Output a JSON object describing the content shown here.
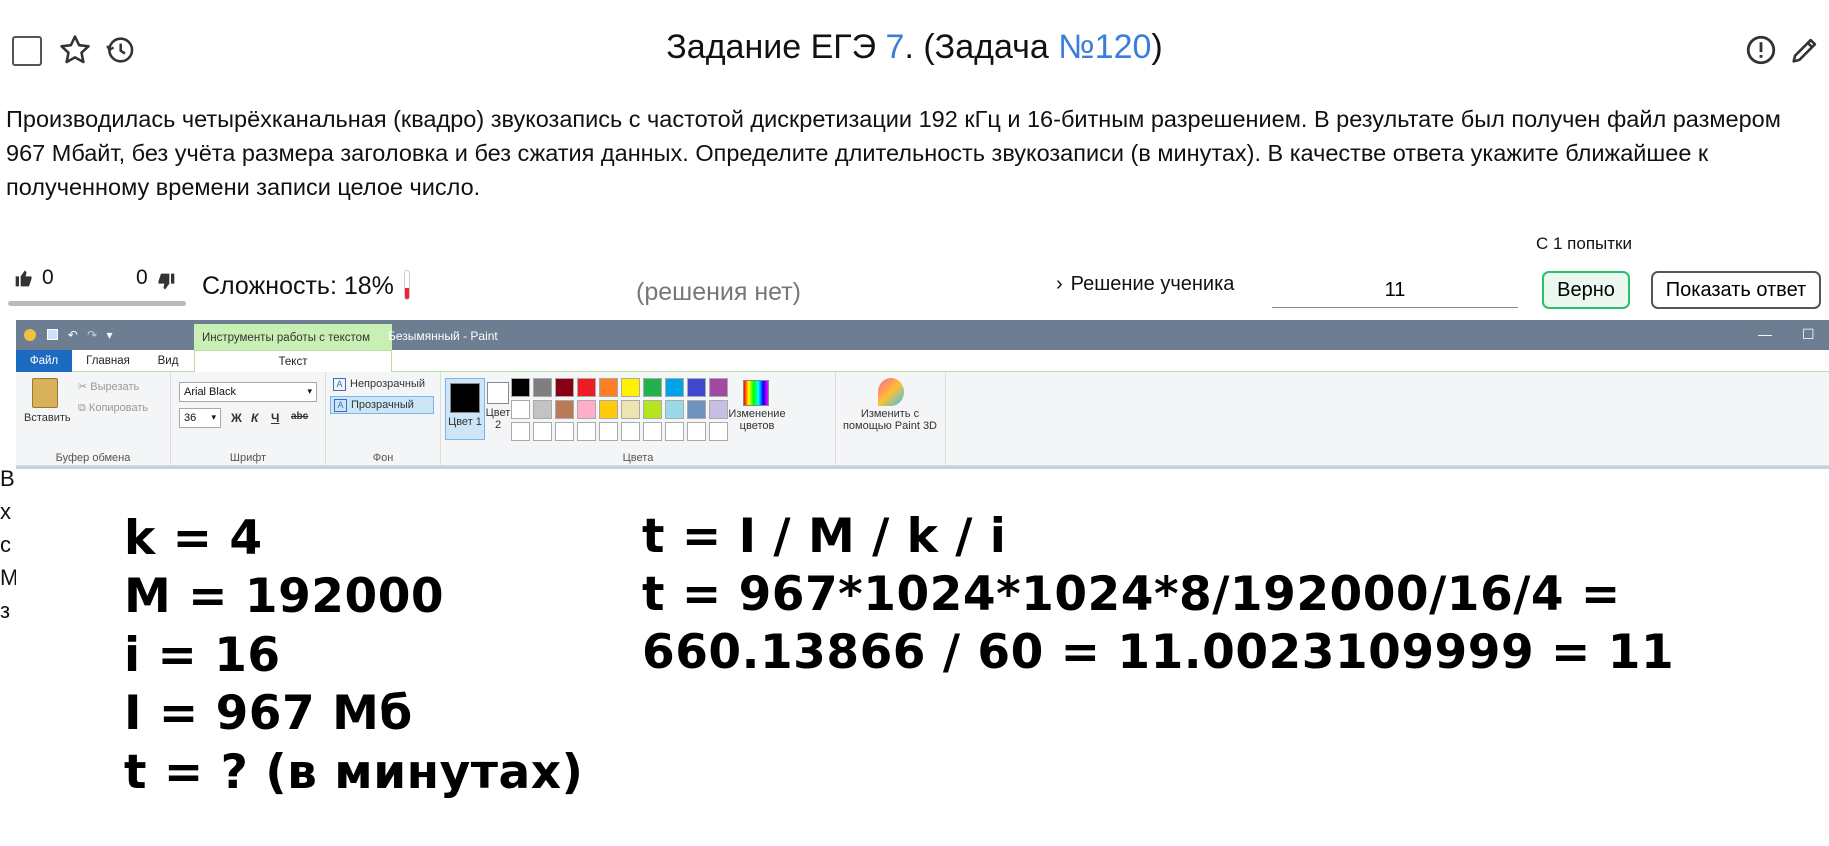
{
  "header": {
    "title_prefix": "Задание ЕГЭ ",
    "task_number": "7",
    "title_middle": ". (Задача ",
    "problem_number": "№120",
    "title_suffix": ")"
  },
  "task_text": "Производилась четырёхканальная (квадро) звукозапись с частотой дискретизации 192 кГц и 16-битным разрешением. В результате был получен файл размером 967 Мбайт, без учёта размера заголовка и без сжатия данных. Определите длительность звукозаписи (в минутах). В качестве ответа укажите ближайшее к полученному времени записи целое число.",
  "stats": {
    "likes": "0",
    "dislikes": "0",
    "difficulty": "Сложность: 18%",
    "difficulty_percent": 18,
    "no_solutions": "(решения нет)",
    "attempt": "С 1 попытки",
    "student_solution": "Решение ученика",
    "answer_value": "11",
    "correct_label": "Верно",
    "show_answer_label": "Показать ответ"
  },
  "paint": {
    "context_tab": "Инструменты работы с текстом",
    "window_title": "Безымянный - Paint",
    "tabs": {
      "file": "Файл",
      "home": "Главная",
      "view": "Вид",
      "text": "Текст"
    },
    "clipboard": {
      "paste": "Вставить",
      "cut": "Вырезать",
      "copy": "Копировать",
      "label": "Буфер обмена"
    },
    "font": {
      "name": "Arial Black",
      "size": "36",
      "bold": "Ж",
      "italic": "К",
      "underline": "Ч",
      "strike": "abc",
      "label": "Шрифт"
    },
    "background": {
      "opaque": "Непрозрачный",
      "transparent": "Прозрачный",
      "label": "Фон"
    },
    "colors": {
      "color1": "Цвет 1",
      "color2": "Цвет 2",
      "edit": "Изменение цветов",
      "label": "Цвета",
      "palette_row1": [
        "#000000",
        "#7f7f7f",
        "#880015",
        "#ed1c24",
        "#ff7f27",
        "#fff200",
        "#22b14c",
        "#00a2e8",
        "#3f48cc",
        "#a349a4"
      ],
      "palette_row2": [
        "#ffffff",
        "#c3c3c3",
        "#b97a57",
        "#ffaec9",
        "#ffc90e",
        "#efe4b0",
        "#b5e61d",
        "#99d9ea",
        "#7092be",
        "#c8bfe7"
      ]
    },
    "paint3d": "Изменить с помощью Paint 3D",
    "canvas_left": [
      "k = 4",
      "M = 192000",
      "i = 16",
      "I = 967 Мб",
      "t = ? (в минутах)"
    ],
    "canvas_right": [
      "t = I / M / k / i",
      "t = 967*1024*1024*8/192000/16/4 =",
      "660.13866 / 60 = 11.0023109999 = 11"
    ]
  }
}
